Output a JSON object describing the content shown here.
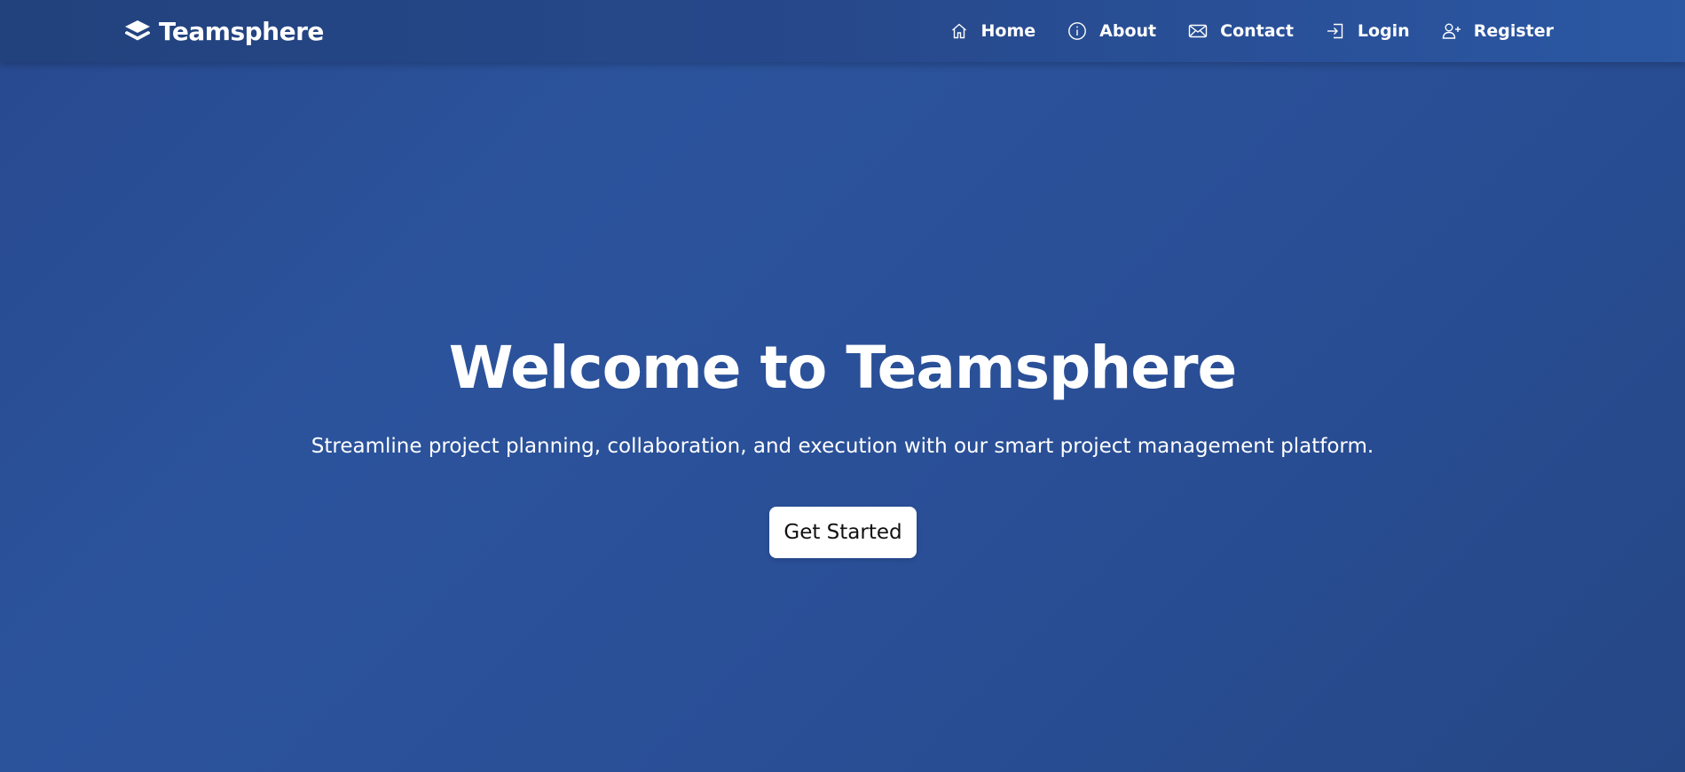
{
  "brand": {
    "name": "Teamsphere",
    "icon": "layers-icon"
  },
  "nav": {
    "items": [
      {
        "label": "Home",
        "icon": "home-icon"
      },
      {
        "label": "About",
        "icon": "info-icon"
      },
      {
        "label": "Contact",
        "icon": "envelope-icon"
      },
      {
        "label": "Login",
        "icon": "login-icon"
      },
      {
        "label": "Register",
        "icon": "user-plus-icon"
      }
    ]
  },
  "hero": {
    "title": "Welcome to Teamsphere",
    "subtitle": "Streamline project planning, collaboration, and execution with our smart project management platform.",
    "cta_label": "Get Started"
  },
  "colors": {
    "background": "#2a4f97",
    "navbar": "#24457f",
    "text": "#ffffff",
    "button_bg": "#ffffff",
    "button_text": "#111111"
  }
}
